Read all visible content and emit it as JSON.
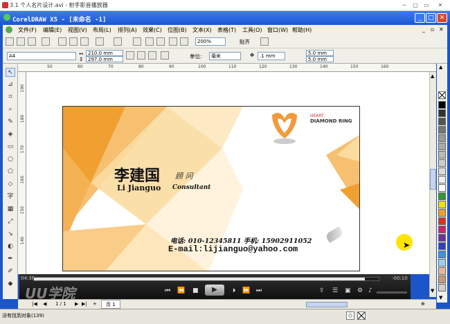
{
  "player": {
    "title": "3.1 个人名片设计.avi - 射手影音播放器",
    "time_elapsed": "04:36",
    "time_remaining": "-00:10",
    "progress": 0.96,
    "watermark": "UU学院"
  },
  "app": {
    "title": "CorelDRAW X5 - [未命名 -1]",
    "menu": [
      "文件(F)",
      "编辑(E)",
      "视图(V)",
      "布局(L)",
      "排列(A)",
      "效果(C)",
      "位图(B)",
      "文本(X)",
      "表格(T)",
      "工具(O)",
      "窗口(W)",
      "帮助(H)"
    ],
    "zoom": "200%",
    "snap_label": "贴齐"
  },
  "props": {
    "paper_size": "A4",
    "width": "210.0 mm",
    "height": "297.0 mm",
    "unit_label": "单位:",
    "unit": "毫米",
    "nudge": ".1 mm",
    "dup_x": "5.0 mm",
    "dup_y": "5.0 mm"
  },
  "ruler": {
    "top": [
      "50",
      "60",
      "70",
      "80",
      "90",
      "100",
      "110",
      "120",
      "130",
      "140",
      "150",
      "160"
    ],
    "left": [
      "190",
      "180",
      "170",
      "160",
      "150",
      "140"
    ]
  },
  "card": {
    "brand_line1": "HEART",
    "brand_line2": "DIAMOND RING",
    "name_cn": "李建国",
    "title_cn": "顾 问",
    "name_en": "Li Jianguo",
    "title_en": "Consultant",
    "phone_line": "电话: 010-12345811  手机: 15902911052",
    "email_line": "E-mail:lijianguo@yahoo.com"
  },
  "pagebar": {
    "page_count": "1 / 1",
    "page_tab": "页 1"
  },
  "status": {
    "text": "没有找到对象(139)"
  },
  "colors": {
    "accent_orange": "#f0a030",
    "xp_blue": "#1b55c9"
  },
  "palette": [
    "#000000",
    "#333333",
    "#555555",
    "#777777",
    "#999999",
    "#aaaaaa",
    "#bbbbbb",
    "#cccccc",
    "#dddddd",
    "#eeeeee",
    "#ffffff",
    "#2f9a2f",
    "#f0e010",
    "#f0a020",
    "#e03020",
    "#d02070",
    "#7030a0",
    "#3040c0",
    "#4090e0",
    "#a0d0f0",
    "#e8b898",
    "#c89878",
    "#d0d0d0"
  ]
}
